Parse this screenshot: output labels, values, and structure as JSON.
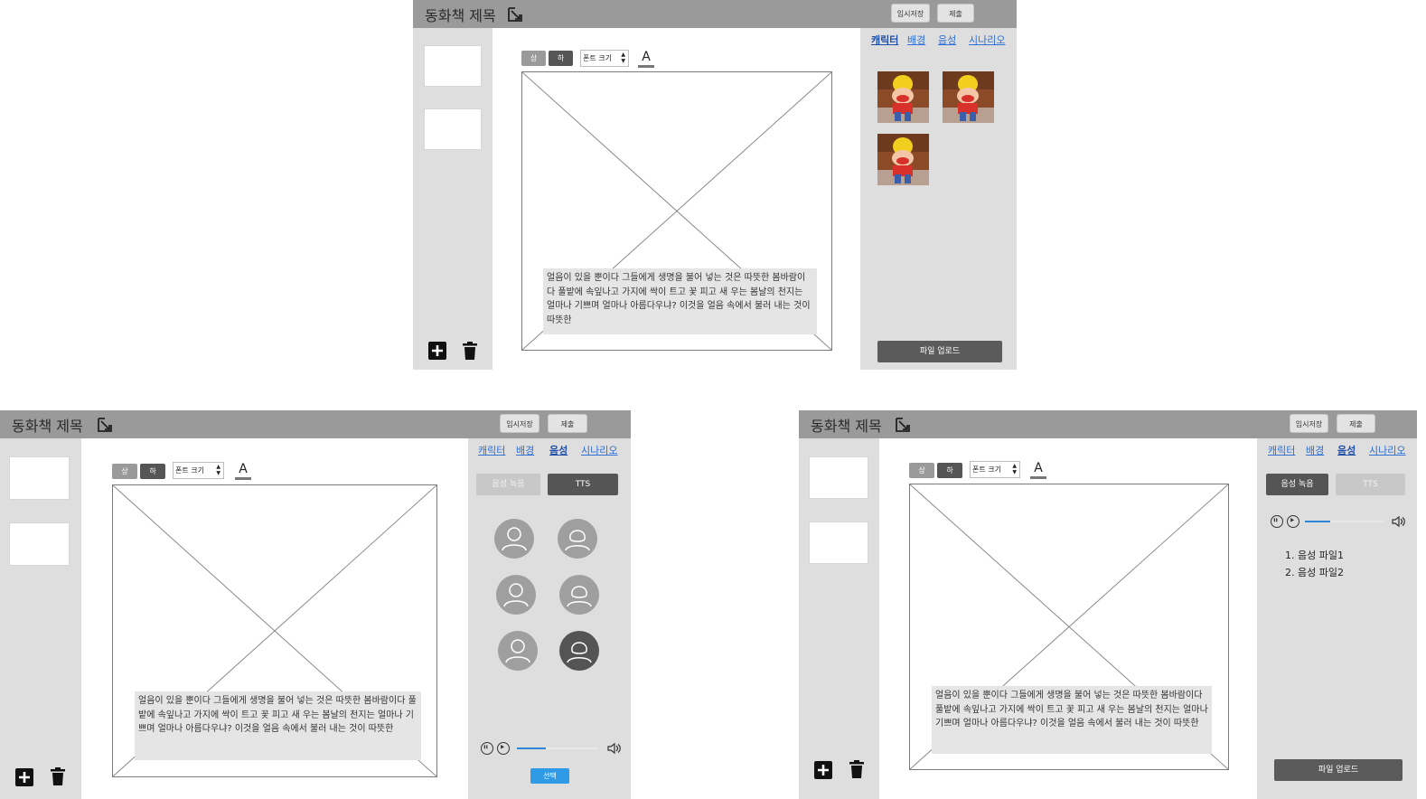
{
  "app": {
    "title": "동화책 제목",
    "save_temp": "임시저장",
    "submit": "제출"
  },
  "format": {
    "up": "상",
    "down": "하",
    "font_size": "폰트 크기",
    "font_color_glyph": "A"
  },
  "story_text": "얼음이 있을 뿐이다 그들에게 생명을 불어 넣는 것은 따뜻한 봄바람이다 풀밭에 속잎나고 가지에 싹이 트고 꽃 피고 새 우는 봄날의 천지는 얼마나 기쁘며 얼마나 아름다우냐? 이것을 얼음 속에서 불러 내는 것이 따뜻한",
  "tabs": [
    "캐릭터",
    "배경",
    "음성",
    "시나리오"
  ],
  "characters": [
    {
      "name": "character-1"
    },
    {
      "name": "character-2"
    },
    {
      "name": "character-3"
    }
  ],
  "upload_label": "파일 업로드",
  "voice": {
    "record_label": "음성 녹음",
    "tts_label": "TTS",
    "select_label": "선택",
    "files": [
      "1. 음성 파일1",
      "2. 음성 파일2"
    ],
    "progress_tts": 0.35,
    "progress_record": 0.32
  },
  "icons": {
    "edit": "edit-icon",
    "add": "plus-square-icon",
    "trash": "trash-icon",
    "pause": "pause-icon",
    "play": "play-icon",
    "volume": "volume-icon",
    "avatar_male": "user-icon",
    "avatar_female": "user-female-icon"
  },
  "colors": {
    "topbar": "#9a9a9a",
    "panel": "#dedede",
    "tab_link": "#2f6fd6",
    "dark_button": "#5b5b5b",
    "accent_blue": "#2f9be6"
  },
  "active_tabs": {
    "frame_top": "캐릭터",
    "frame_bottom_left": "음성",
    "frame_bottom_right": "음성"
  }
}
